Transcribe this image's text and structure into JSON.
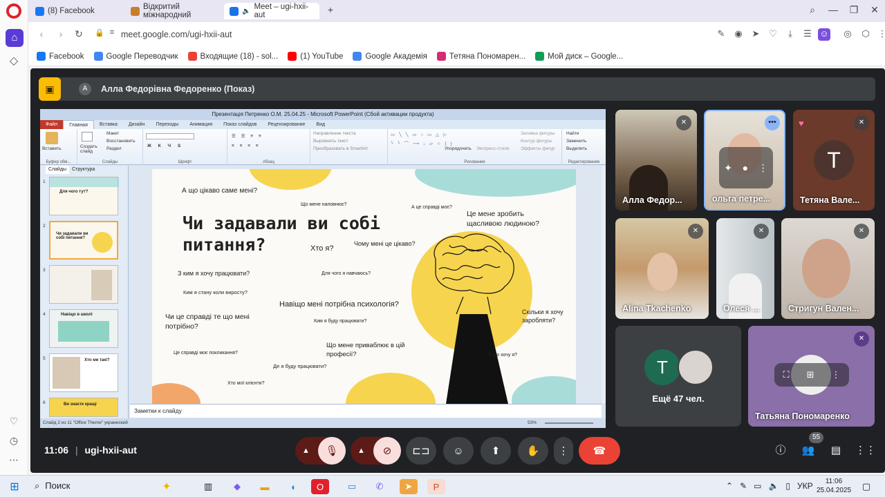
{
  "browser": {
    "tabs": [
      {
        "label": "(8) Facebook",
        "icon": "facebook-icon",
        "color": "#1877f2"
      },
      {
        "label": "Відкритий міжнародний",
        "icon": "page-icon",
        "color": "#c77d2b"
      },
      {
        "label": "Meet – ugi-hxii-aut",
        "icon": "meet-icon",
        "color": "#1a73e8"
      }
    ],
    "url": "meet.google.com/ugi-hxii-aut",
    "bookmarks": [
      {
        "label": "Facebook",
        "color": "#1877f2",
        "glyph": "f"
      },
      {
        "label": "Google Переводчик",
        "color": "#4285f4",
        "glyph": "G"
      },
      {
        "label": "Входящие (18) - sol...",
        "color": "#ea4335",
        "glyph": "M"
      },
      {
        "label": "(1) YouTube",
        "color": "#ff0000",
        "glyph": "▶"
      },
      {
        "label": "Google Академія",
        "color": "#4285f4",
        "glyph": "◆"
      },
      {
        "label": "Тетяна Пономарен...",
        "color": "#d62976",
        "glyph": "◎"
      },
      {
        "label": "Мой диск – Google...",
        "color": "#0f9d58",
        "glyph": "▲"
      }
    ]
  },
  "meet": {
    "presenter_initial": "А",
    "presenter_title": "Алла Федорівна Федоренко (Показ)",
    "meeting_code": "ugi-hxii-aut",
    "time": "11:06",
    "participants_count": "55",
    "tiles": [
      {
        "name": "Алла Федор..."
      },
      {
        "name": "ольга петре..."
      },
      {
        "name": "Тетяна Вале...",
        "initial": "Т"
      },
      {
        "name": "Alina Tkachenko"
      },
      {
        "name": "Олеся ..."
      },
      {
        "name": "Стригун Вален..."
      },
      {
        "name": "Ещё 47 чел.",
        "initial": "Т"
      },
      {
        "name": "Татьяна Пономаренко"
      }
    ]
  },
  "ppt": {
    "title": "Презентація Петренко О.М. 25.04.25 - Microsoft PowerPoint (Сбой активации продукта)",
    "tabs": [
      "Файл",
      "Главная",
      "Вставка",
      "Дизайн",
      "Переходы",
      "Анимация",
      "Показ слайдов",
      "Рецензирование",
      "Вид"
    ],
    "ribbon": {
      "paste": "Вставить",
      "new_slide": "Создать слайд",
      "layout": "Макет",
      "reset": "Восстановить",
      "section": "Раздел",
      "text_direction": "Направление текста",
      "align_text": "Выровнять текст",
      "smartart": "Преобразовать в SmartArt",
      "arrange": "Упорядочить",
      "quick_styles": "Экспресс-стили",
      "fill": "Заливка фигуры",
      "outline": "Контур фигуры",
      "effects": "Эффекты фигур",
      "find": "Найти",
      "replace": "Заменить",
      "select": "Выделить",
      "groups": [
        "Буфер обм...",
        "Слайды",
        "Шрифт",
        "Абзац",
        "Рисование",
        "Редактирование"
      ]
    },
    "panel_tabs": [
      "Слайды",
      "Структура"
    ],
    "notes": "Заметки к слайду",
    "status": "Слайд 2 из 11   \"Office Theme\"   украинский",
    "zoom": "53%",
    "thumb_labels": {
      "s1": "Для чого тут?",
      "s2": "Чи задавали ви собі питання?",
      "s4": "Навіщо в школі",
      "s5": "Хто ми такі?",
      "s6": "Ви знаєте кращі"
    },
    "slide": {
      "title": "Чи задавали ви собі питання?",
      "q1": "А що цікаво саме мені?",
      "q2": "Що мене наповнює?",
      "q3": "А це справді моє?",
      "q4": "Це мене зробить щасливою людиною?",
      "q5": "Хто я?",
      "q6": "Чому мені це цікаво?",
      "q7": "З ким я хочу працювати?",
      "q8": "Для чого я навчаюсь?",
      "q9": "Ким я стану коли виросту?",
      "q10": "Навіщо мені потрібна психологія?",
      "q11": "Чи це справді те що мені потрібно?",
      "q12": "Ким я буду працювати?",
      "q13": "Скільки я хочу заробляти?",
      "q14": "Що мене приваблює в цій професії?",
      "q15": "Це справді моє покликання?",
      "q16": "Де я буду працювати?",
      "q17": "А що хочу я?",
      "q18": "Хто мої клієнти?"
    }
  },
  "taskbar": {
    "search": "Поиск",
    "lang": "УКР",
    "time": "11:06",
    "date": "25.04.2025"
  },
  "colors": {
    "hangup": "#ea4335",
    "accent": "#8ab4f8",
    "presenter": "#fbbc04"
  }
}
